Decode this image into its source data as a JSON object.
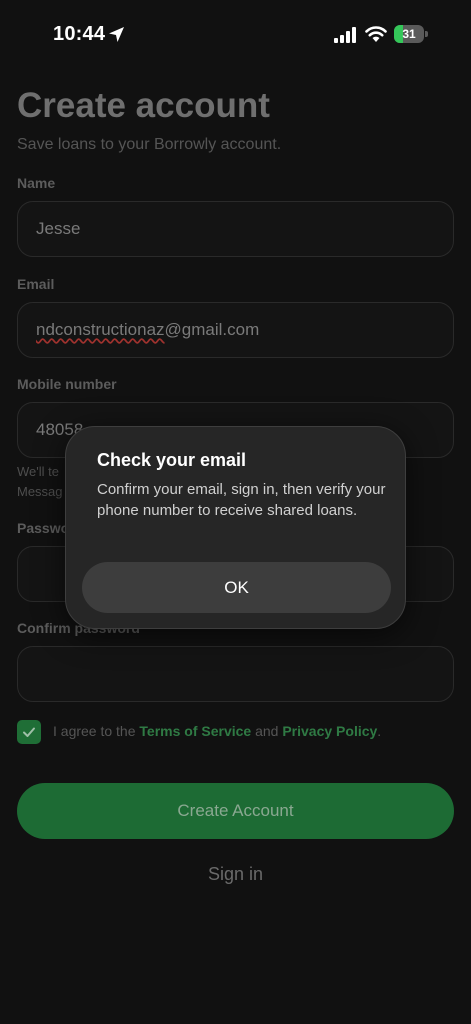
{
  "status_bar": {
    "time": "10:44",
    "battery": "31",
    "battery_level": 0.31
  },
  "header": {
    "title": "Create account",
    "subtitle": "Save loans to your Borrowly account."
  },
  "fields": {
    "name": {
      "label": "Name",
      "value": "Jesse"
    },
    "email": {
      "value_underlined": "ndconstructionaz",
      "value_rest": "@gmail.com",
      "label": "Email"
    },
    "mobile": {
      "label": "Mobile number",
      "value": "48058"
    },
    "helper_line1": "We'll te",
    "helper_line2": "Messag",
    "password": {
      "label": "Passwo"
    },
    "confirm_password": {
      "label": "Confirm password"
    }
  },
  "agreement": {
    "prefix": "I agree to the ",
    "terms": "Terms of Service",
    "and": " and ",
    "privacy": "Privacy Policy",
    "suffix": ".",
    "checked": true
  },
  "buttons": {
    "create_account": "Create Account",
    "sign_in": "Sign in"
  },
  "dialog": {
    "title": "Check your email",
    "message": "Confirm your email, sign in, then verify your phone number to receive shared loans.",
    "ok": "OK"
  },
  "colors": {
    "accent": "#1d6b34",
    "link": "#2f7a44",
    "background": "#111111",
    "dialog": "#262626"
  },
  "icons": [
    "location-arrow-icon",
    "cellular-signal-icon",
    "wifi-icon",
    "battery-icon",
    "checkmark-icon"
  ]
}
